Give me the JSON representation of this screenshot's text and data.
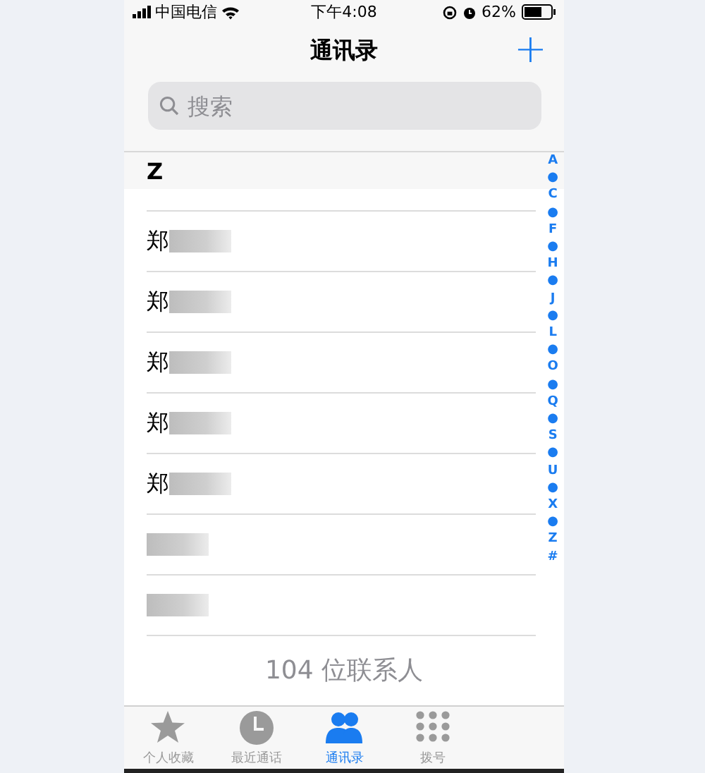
{
  "status_bar": {
    "carrier": "中国电信",
    "time": "下午4:08",
    "battery": "62%"
  },
  "nav": {
    "title": "通讯录",
    "add": "+"
  },
  "search": {
    "placeholder": "搜索"
  },
  "section": {
    "letter": "Z"
  },
  "contacts": [
    {
      "blurred": false
    },
    {
      "name": "郑",
      "blurred": true
    },
    {
      "name": "郑",
      "blurred": true
    },
    {
      "name": "郑",
      "blurred": true
    },
    {
      "name": "郑",
      "blurred": true
    },
    {
      "name": "郑",
      "blurred": true
    },
    {
      "blurred": true
    },
    {
      "blurred": true
    }
  ],
  "count": "104 位联系人",
  "index": [
    "A",
    "●",
    "C",
    "●",
    "F",
    "●",
    "H",
    "●",
    "J",
    "●",
    "L",
    "●",
    "O",
    "●",
    "Q",
    "●",
    "S",
    "●",
    "U",
    "●",
    "X",
    "●",
    "Z",
    "#"
  ],
  "tabs": [
    {
      "kind": "star",
      "label": "个人收藏",
      "selected": false
    },
    {
      "kind": "clock",
      "label": "最近通话",
      "selected": false
    },
    {
      "kind": "people",
      "label": "通讯录",
      "selected": true
    },
    {
      "kind": "keypad",
      "label": "拨号",
      "selected": false
    }
  ]
}
